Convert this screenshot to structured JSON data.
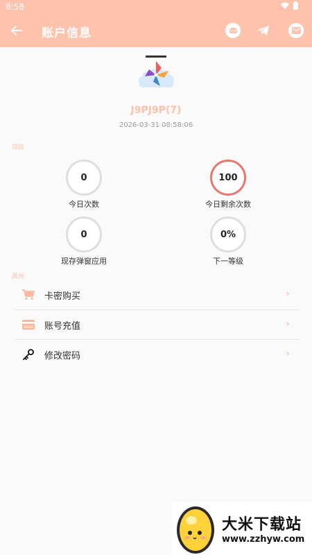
{
  "status_bar": {
    "time": "8:58",
    "icons": [
      "wifi-icon",
      "battery-icon"
    ]
  },
  "app_bar": {
    "title": "账户信息",
    "back_icon": "arrow-left-icon",
    "actions": [
      "discord-icon",
      "telegram-icon",
      "mail-icon"
    ]
  },
  "profile": {
    "avatar_icon": "pinwheel-cloud-avatar",
    "username": "J9PJ9P(7)",
    "timestamp": "2026-03-31 08:58:06"
  },
  "sections": {
    "items_label": "项目",
    "other_label": "其他"
  },
  "stats": [
    {
      "value": "0",
      "label": "今日次数"
    },
    {
      "value": "100",
      "label": "今日剩余次数"
    },
    {
      "value": "0",
      "label": "现存弹窗应用"
    },
    {
      "value": "0%",
      "label": "下一等级"
    }
  ],
  "menu": [
    {
      "label": "卡密购买",
      "icon": "cart-icon"
    },
    {
      "label": "账号充值",
      "icon": "credit-card-icon"
    },
    {
      "label": "修改密码",
      "icon": "key-icon"
    }
  ],
  "watermark": {
    "title": "大米下载站",
    "url": "www.zzhyw.com"
  },
  "colors": {
    "accent": "#ffc2ad",
    "hot_ring": "#e8766c"
  }
}
